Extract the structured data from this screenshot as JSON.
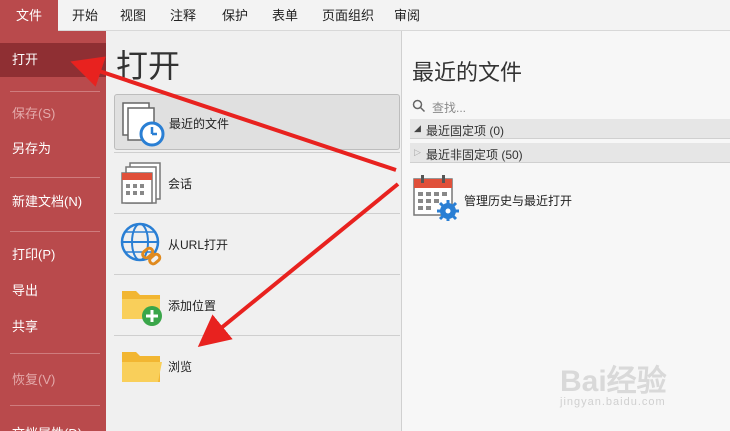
{
  "ribbon_tabs": [
    "文件",
    "开始",
    "视图",
    "注释",
    "保护",
    "表单",
    "页面组织",
    "审阅"
  ],
  "nav": {
    "open": "打开",
    "save": "保存(S)",
    "save_as": "另存为",
    "new_doc": "新建文档(N)",
    "print": "打印(P)",
    "export": "导出",
    "share": "共享",
    "restore": "恢复(V)",
    "doc_props": "文档属性(D)"
  },
  "middle": {
    "title": "打开",
    "options": [
      {
        "label": "最近的文件",
        "icon": "recent-files-clock-icon"
      },
      {
        "label": "会话",
        "icon": "session-calendar-icon"
      },
      {
        "label": "从URL打开",
        "icon": "globe-link-icon"
      },
      {
        "label": "添加位置",
        "icon": "folder-add-icon"
      },
      {
        "label": "浏览",
        "icon": "folder-icon"
      }
    ]
  },
  "right": {
    "title": "最近的文件",
    "search_placeholder": "查找...",
    "pinned_group": "最近固定项 (0)",
    "unpinned_group": "最近非固定项 (50)",
    "manage_label": "管理历史与最近打开"
  },
  "watermark": {
    "brand": "Bai经验",
    "url": "jingyan.baidu.com"
  },
  "colors": {
    "accent": "#b94a4c",
    "selected_nav": "#8f2f33",
    "arrow": "#e8221f"
  }
}
